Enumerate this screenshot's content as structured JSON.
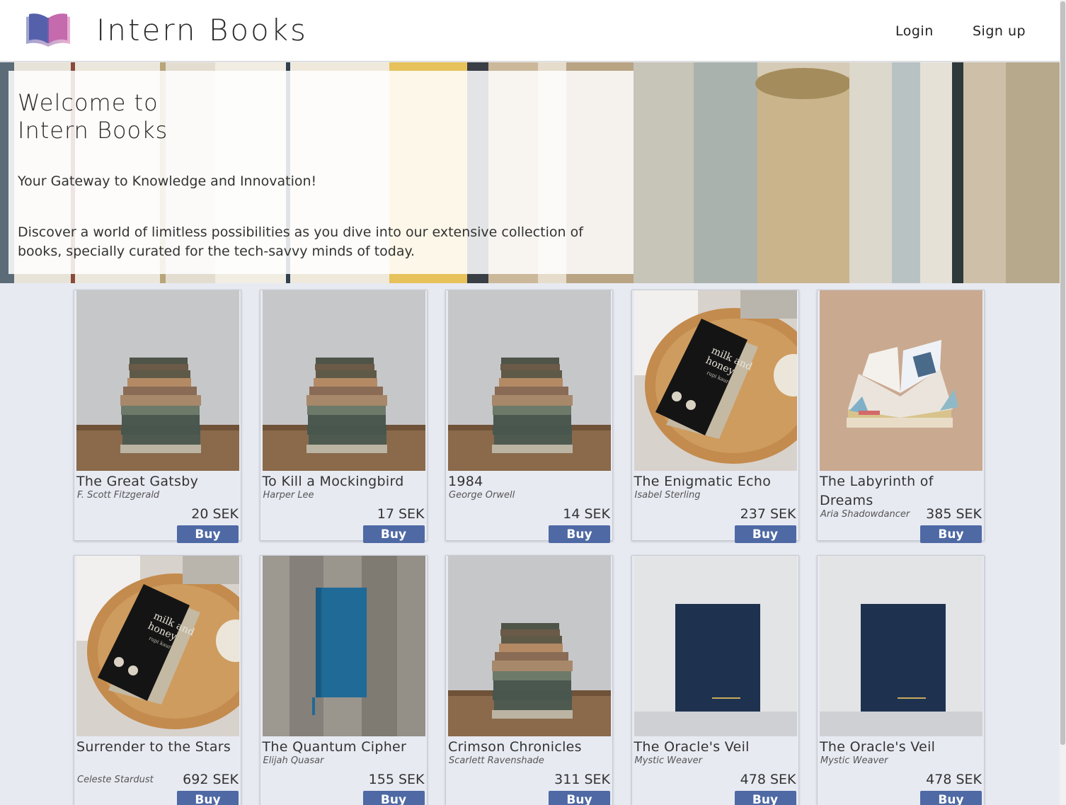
{
  "header": {
    "brand": "Intern Books",
    "login_label": "Login",
    "signup_label": "Sign up"
  },
  "hero": {
    "title_line1": "Welcome to",
    "title_line2": "Intern Books",
    "tagline": "Your Gateway to Knowledge and Innovation!",
    "description": "Discover a world of limitless possibilities as you dive into our extensive collection of books, specially curated for the tech-savvy minds of today."
  },
  "books": [
    {
      "title": "The Great Gatsby",
      "author": "F. Scott Fitzgerald",
      "price": "20 SEK",
      "buy": "Buy",
      "cover": "stack"
    },
    {
      "title": "To Kill a Mockingbird",
      "author": "Harper Lee",
      "price": "17 SEK",
      "buy": "Buy",
      "cover": "stack"
    },
    {
      "title": "1984",
      "author": "George Orwell",
      "price": "14 SEK",
      "buy": "Buy",
      "cover": "stack"
    },
    {
      "title": "The Enigmatic Echo",
      "author": "Isabel Sterling",
      "price": "237 SEK",
      "buy": "Buy",
      "cover": "milk"
    },
    {
      "title": "The Labyrinth of Dreams",
      "author": "Aria Shadowdancer",
      "price": "385 SEK",
      "buy": "Buy",
      "cover": "open"
    },
    {
      "title": "Surrender to the Stars",
      "author": "Celeste Stardust",
      "price": "692 SEK",
      "buy": "Buy",
      "cover": "milk"
    },
    {
      "title": "The Quantum Cipher",
      "author": "Elijah Quasar",
      "price": "155 SEK",
      "buy": "Buy",
      "cover": "blue"
    },
    {
      "title": "Crimson Chronicles",
      "author": "Scarlett Ravenshade",
      "price": "311 SEK",
      "buy": "Buy",
      "cover": "stack"
    },
    {
      "title": "The Oracle's Veil",
      "author": "Mystic Weaver",
      "price": "478 SEK",
      "buy": "Buy",
      "cover": "navy"
    },
    {
      "title": "The Oracle's Veil",
      "author": "Mystic Weaver",
      "price": "478 SEK",
      "buy": "Buy",
      "cover": "navy"
    }
  ],
  "cover_text": {
    "milk_line1": "milk and",
    "milk_line2": "honey",
    "milk_author": "rupi kaur"
  },
  "colors": {
    "accent": "#4e69a4",
    "background": "#e8eaf2"
  }
}
